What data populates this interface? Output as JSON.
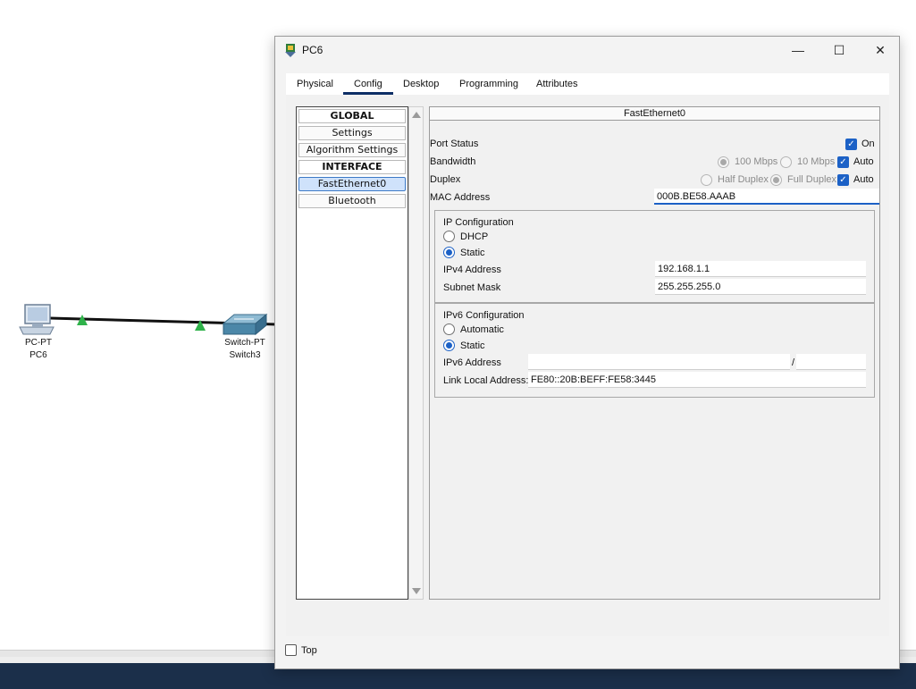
{
  "topology": {
    "pc": {
      "type_label": "PC-PT",
      "name_label": "PC6"
    },
    "switch": {
      "type_label": "Switch-PT",
      "name_label": "Switch3"
    }
  },
  "window": {
    "title": "PC6",
    "minimize_glyph": "—",
    "maximize_glyph": "☐",
    "close_glyph": "✕"
  },
  "tabs": [
    {
      "label": "Physical"
    },
    {
      "label": "Config"
    },
    {
      "label": "Desktop"
    },
    {
      "label": "Programming"
    },
    {
      "label": "Attributes"
    }
  ],
  "active_tab": "Config",
  "nav": {
    "items": [
      {
        "label": "GLOBAL"
      },
      {
        "label": "Settings"
      },
      {
        "label": "Algorithm Settings"
      },
      {
        "label": "INTERFACE"
      },
      {
        "label": "FastEthernet0"
      },
      {
        "label": "Bluetooth"
      }
    ],
    "selected": "FastEthernet0"
  },
  "interface": {
    "header": "FastEthernet0",
    "port_status_label": "Port Status",
    "on_label": "On",
    "bandwidth_label": "Bandwidth",
    "bandwidth_options": [
      "100 Mbps",
      "10 Mbps"
    ],
    "auto_label": "Auto",
    "duplex_label": "Duplex",
    "duplex_options": [
      "Half Duplex",
      "Full Duplex"
    ],
    "mac_label": "MAC Address",
    "mac_value": "000B.BE58.AAAB"
  },
  "ip_config": {
    "title": "IP Configuration",
    "dhcp_label": "DHCP",
    "static_label": "Static",
    "ipv4_label": "IPv4 Address",
    "ipv4_value": "192.168.1.1",
    "mask_label": "Subnet Mask",
    "mask_value": "255.255.255.0"
  },
  "ipv6_config": {
    "title": "IPv6 Configuration",
    "automatic_label": "Automatic",
    "static_label": "Static",
    "ipv6_label": "IPv6 Address",
    "ipv6_value": "",
    "prefix_separator": "/",
    "prefix_value": "",
    "link_local_label": "Link Local Address:",
    "link_local_value": "FE80::20B:BEFF:FE58:3445"
  },
  "footer": {
    "top_label": "Top"
  },
  "colors": {
    "accent": "#1c61c6",
    "tab_underline": "#0e2f66",
    "taskbar": "#1b2f4a",
    "link_triangle": "#2fb24a"
  }
}
